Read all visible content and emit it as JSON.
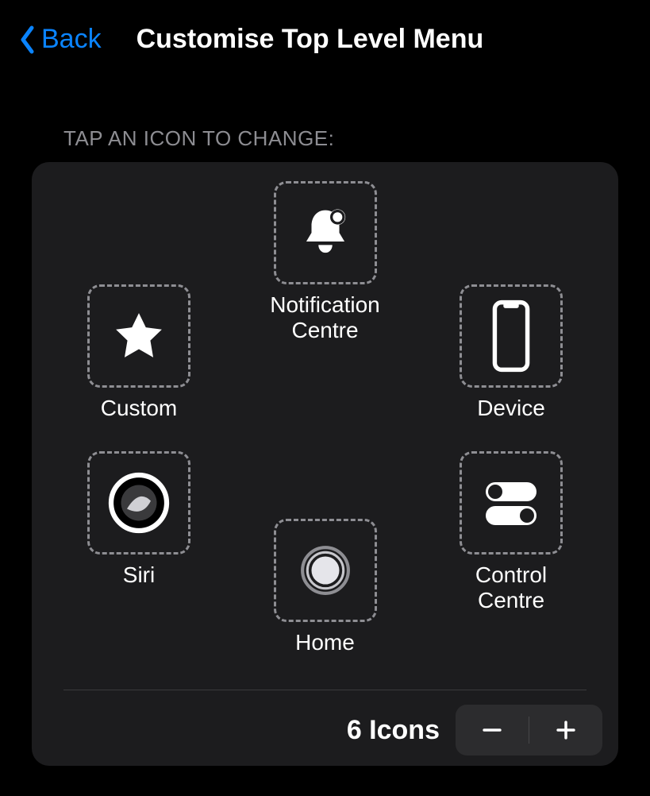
{
  "nav": {
    "back_label": "Back",
    "title": "Customise Top Level Menu"
  },
  "section_label": "TAP AN ICON TO CHANGE:",
  "slots": {
    "top": {
      "label": "Notification\nCentre",
      "icon": "bell-badge-icon"
    },
    "tl": {
      "label": "Custom",
      "icon": "star-icon"
    },
    "tr": {
      "label": "Device",
      "icon": "phone-outline-icon"
    },
    "bl": {
      "label": "Siri",
      "icon": "siri-icon"
    },
    "br": {
      "label": "Control\nCentre",
      "icon": "toggles-icon"
    },
    "bottom": {
      "label": "Home",
      "icon": "home-button-icon"
    }
  },
  "footer": {
    "count_label": "6 Icons"
  }
}
